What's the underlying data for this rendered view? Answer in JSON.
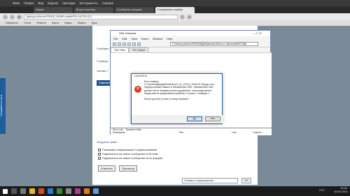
{
  "browser": {
    "menu": [
      "Файл",
      "Правка",
      "Вид",
      "Журнал",
      "Закладки",
      "Инструменты",
      "Справка"
    ],
    "tabs": [
      {
        "label": "Форум",
        "active": false
      },
      {
        "label": "Вход в систему",
        "active": false
      },
      {
        "label": "Сообщения форума",
        "active": false
      },
      {
        "label": "Сохранение ошибки",
        "active": true
      }
    ],
    "url": "pkprog.ru/forum/?PAGE_NAME=read&FID=1&TID=221",
    "bookmarks": [
      "Избранное",
      "Почта",
      "Новости",
      "Карты",
      "Видео",
      "Маркет",
      "Диск"
    ]
  },
  "page": {
    "social_label": "Сохраните в сети",
    "labels": [
      "Сообщен",
      "Страниц",
      "Читают т"
    ],
    "header": "Ответить",
    "links": [
      "Загрузить файл"
    ],
    "checkboxes": [
      "Показывать информацию о редактировании",
      "Подписаться на новые сообщения этой темы",
      "Подписаться на новые сообщения этого форума"
    ],
    "reply_button": "Ответить",
    "preview_button": "Просмотр",
    "dropdown": "Отзывы и предложения",
    "go_button": "OK"
  },
  "xml_notepad": {
    "title": "XML Notepad",
    "menu": [
      "File",
      "Edit",
      "View",
      "Insert",
      "Window",
      "Help"
    ],
    "path": "F:\\Новые работы\\ПИРАМИДА\\Красный Волга от Школьник\\НЕГОДЕ",
    "tabs": [
      "Tree View",
      "XSL Output"
    ],
    "error_tabs": [
      "Error List",
      "Dynamic Help"
    ],
    "error_columns": [
      "Description",
      "File",
      "Line",
      "Column"
    ]
  },
  "dialog": {
    "title": "Load Error",
    "text": [
      "Error loading",
      "C:\\Users\\Надежда\\Desktop\\23_01_01212_2018-04-28.jpg1.xml:",
      "Недопустимый символ в объявлении XML. Объявление XML",
      "должно быть первым узлом в документе, непосредственно",
      "перед ним не допускаются пробелы. Строка 2, позиция 1.",
      "",
      "Would you like to open it using Notepad?"
    ],
    "yes": "Да",
    "no": "Нет"
  },
  "taskbar": {
    "time": "20:04",
    "date": "28.05.2018",
    "lang": "РУС"
  },
  "colors": {
    "accent": "#21508a",
    "error": "#d83b1e",
    "desktop": "#1e1e1e"
  }
}
